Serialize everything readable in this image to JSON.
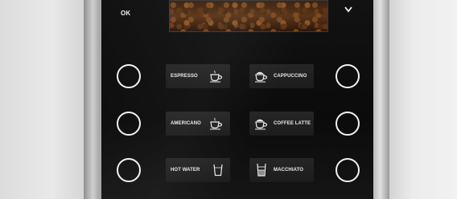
{
  "display": {
    "ok_label": "OK"
  },
  "drinks": {
    "left": [
      {
        "label": "ESPRESSO",
        "icon": "espresso-cup-icon"
      },
      {
        "label": "AMERICANO",
        "icon": "coffee-cup-icon"
      },
      {
        "label": "HOT WATER",
        "icon": "glass-icon"
      }
    ],
    "right": [
      {
        "label": "CAPPUCCINO",
        "icon": "cappuccino-cup-icon"
      },
      {
        "label": "COFFEE LATTE",
        "icon": "latte-cup-icon"
      },
      {
        "label": "MACCHIATO",
        "icon": "macchiato-glass-icon"
      }
    ]
  },
  "colors": {
    "panel": "#0b0b0b",
    "button": "#1c1c1c",
    "text": "#eaeaea",
    "ring": "#f2f2f2"
  }
}
